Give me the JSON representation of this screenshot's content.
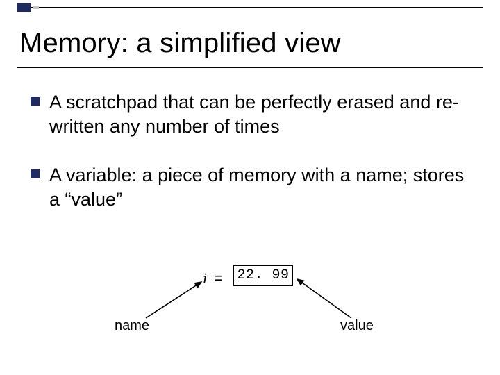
{
  "title": "Memory: a simplified view",
  "bullets": [
    "A scratchpad that can be perfectly erased and re-written any number of times",
    "A variable: a piece of memory with a name; stores a “value”"
  ],
  "diagram": {
    "var_name": "i",
    "equals": "=",
    "value": "22. 99",
    "name_label": "name",
    "value_label": "value"
  }
}
